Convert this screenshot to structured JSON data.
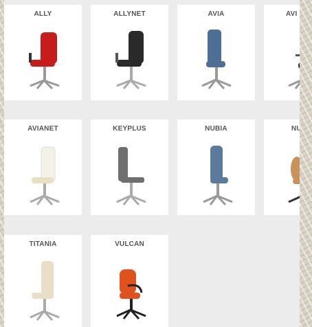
{
  "products": [
    {
      "name": "ALLY",
      "seat": "#c61c1c",
      "back": "#c61c1c"
    },
    {
      "name": "ALLYNET",
      "seat": "#2a2a2a",
      "back": "#2a2a2a"
    },
    {
      "name": "AVIA",
      "seat": "#4d6f96",
      "back": "#4d6f96"
    },
    {
      "name": "AVI",
      "seat": "#2a2a2a",
      "back": "#2a2a2a"
    },
    {
      "name": "AVIANET",
      "seat": "#e9dfc3",
      "back": "#f4f1e8"
    },
    {
      "name": "KEYPLUS",
      "seat": "#6f6f6f",
      "back": "#6f6f6f"
    },
    {
      "name": "NUBIA",
      "seat": "#5b7a9c",
      "back": "#5b7a9c"
    },
    {
      "name": "NU",
      "seat": "#c9925d",
      "back": "#c9925d"
    },
    {
      "name": "TITANIA",
      "seat": "#e8dfc6",
      "back": "#e8dfc6"
    },
    {
      "name": "VULCAN",
      "seat": "#e0521d",
      "back": "#e0521d"
    }
  ]
}
